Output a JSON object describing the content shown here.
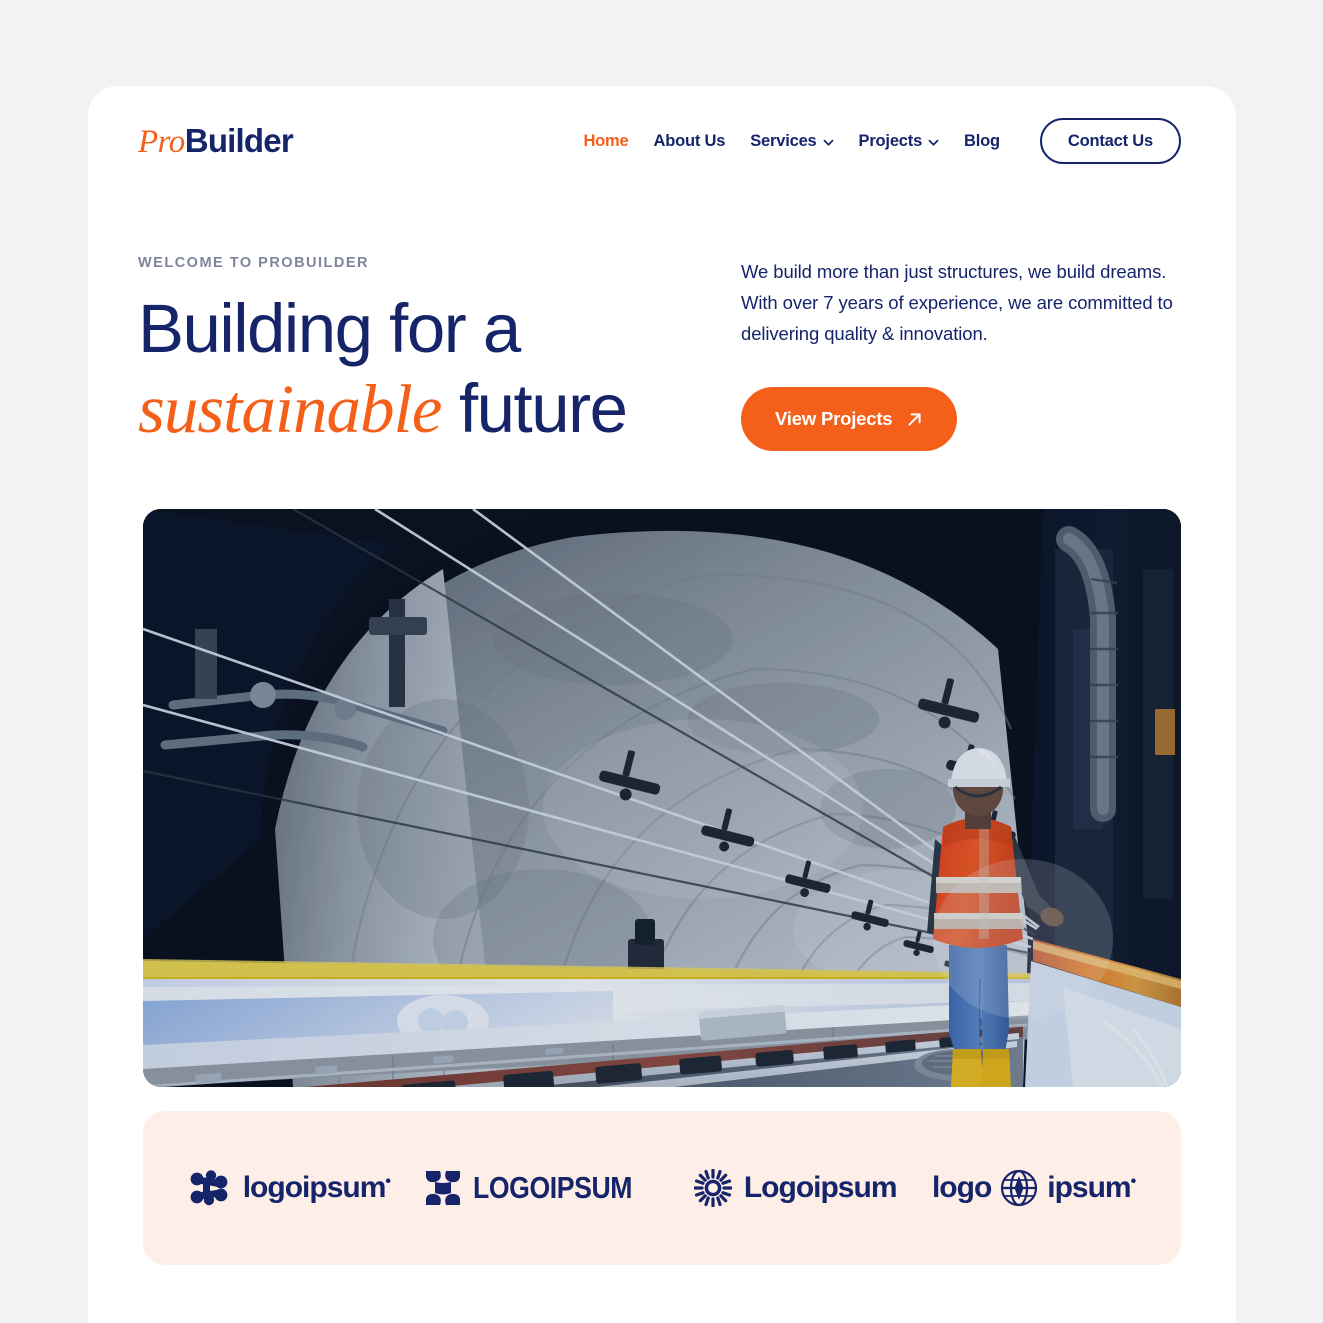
{
  "brand": {
    "part1": "Pro",
    "part2": "Builder",
    "accent_color": "#f4601a",
    "navy_color": "#16246a"
  },
  "nav": {
    "items": [
      {
        "label": "Home",
        "active": true,
        "has_dropdown": false,
        "icon": null
      },
      {
        "label": "About Us",
        "active": false,
        "has_dropdown": false,
        "icon": null
      },
      {
        "label": "Services",
        "active": false,
        "has_dropdown": true,
        "icon": "chevron-down-icon"
      },
      {
        "label": "Projects",
        "active": false,
        "has_dropdown": true,
        "icon": "chevron-down-icon"
      },
      {
        "label": "Blog",
        "active": false,
        "has_dropdown": false,
        "icon": null
      }
    ],
    "contact_label": "Contact Us"
  },
  "hero": {
    "eyebrow": "WELCOME TO PROBUILDER",
    "headline_line1": "Building for a",
    "headline_emphasis": "sustainable",
    "headline_tail": " future",
    "copy": "We build more than just structures, we build dreams. With over 7 years of experience, we are committed to delivering quality & innovation.",
    "cta_label": "View Projects",
    "cta_icon": "arrow-up-right-icon",
    "image_alt": "Railway tunnel interior with worker in orange hi-vis vest walking beside the tracks"
  },
  "logos": {
    "background_color": "#fdeee8",
    "items": [
      {
        "mark": "molecule-dots-icon",
        "text": "logoipsum",
        "trademark": "•",
        "style": "lower"
      },
      {
        "mark": "butterfly-x-icon",
        "text": "LOGOIPSUM",
        "trademark": "",
        "style": "condensed-upper"
      },
      {
        "mark": "sunburst-icon",
        "text": "Logoipsum",
        "trademark": "",
        "style": "lower"
      },
      {
        "mark": "globe-icon",
        "text_before": "logo",
        "text_after": "ipsum",
        "trademark": "•",
        "style": "split"
      }
    ]
  }
}
